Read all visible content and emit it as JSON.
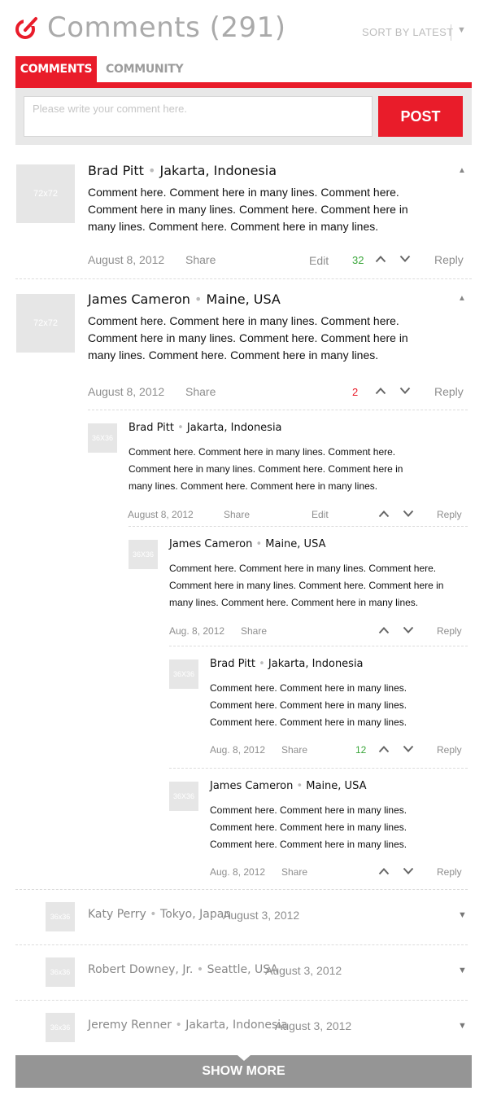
{
  "header": {
    "title": "Comments (291)",
    "sort_label": "SORT BY LATEST",
    "accent": "#e91c2a"
  },
  "tabs": [
    {
      "label": "COMMENTS",
      "active": true
    },
    {
      "label": "COMMUNITY",
      "active": false
    }
  ],
  "composer": {
    "placeholder": "Please write your comment here.",
    "post_label": "POST"
  },
  "placeholders": {
    "large": "72x72",
    "small": "36X36",
    "small_alt": "36x36"
  },
  "comments": [
    {
      "name": "Brad Pitt",
      "location": "Jakarta, Indonesia",
      "lines": [
        "Comment here. Comment here in many lines. Comment here.",
        "Comment here in many lines. Comment here. Comment here in",
        "many lines. Comment here. Comment here in many lines."
      ],
      "date": "August 8, 2012",
      "share": "Share",
      "edit": "Edit",
      "score": "32",
      "reply": "Reply"
    },
    {
      "name": "James Cameron",
      "location": "Maine, USA",
      "lines": [
        "Comment here. Comment here in many lines. Comment here.",
        "Comment here in many lines. Comment here. Comment here in",
        "many lines. Comment here. Comment here in many lines."
      ],
      "date": "August 8, 2012",
      "share": "Share",
      "score": "2",
      "reply": "Reply"
    },
    {
      "name": "Brad Pitt",
      "location": "Jakarta, Indonesia",
      "lines": [
        "Comment here. Comment here in many lines. Comment here.",
        "Comment here in many lines. Comment here. Comment here in",
        "many lines. Comment here. Comment here in many lines."
      ],
      "date": "August 8, 2012",
      "share": "Share",
      "edit": "Edit",
      "reply": "Reply"
    },
    {
      "name": "James Cameron",
      "location": "Maine, USA",
      "lines": [
        "Comment here. Comment here in many lines. Comment here.",
        "Comment here in many lines. Comment here. Comment here in",
        "many lines. Comment here. Comment here in many lines."
      ],
      "date": "Aug. 8, 2012",
      "share": "Share",
      "reply": "Reply"
    },
    {
      "name": "Brad Pitt",
      "location": "Jakarta, Indonesia",
      "lines": [
        "Comment here. Comment here in many lines.",
        "Comment here. Comment here in many lines.",
        "Comment here. Comment here in many lines."
      ],
      "date": "Aug. 8, 2012",
      "share": "Share",
      "score": "12",
      "reply": "Reply"
    },
    {
      "name": "James Cameron",
      "location": "Maine, USA",
      "lines": [
        "Comment here. Comment here in many lines.",
        "Comment here. Comment here in many lines.",
        "Comment here. Comment here in many lines."
      ],
      "date": "Aug. 8, 2012",
      "share": "Share",
      "reply": "Reply"
    }
  ],
  "collapsed": [
    {
      "name": "Katy Perry",
      "location": "Tokyo, Japan",
      "date": "August 3, 2012"
    },
    {
      "name": "Robert Downey, Jr.",
      "location": "Seattle, USA",
      "date": "August 3, 2012"
    },
    {
      "name": "Jeremy Renner",
      "location": "Jakarta, Indonesia",
      "date": "August 3, 2012"
    }
  ],
  "show_more_label": "SHOW MORE",
  "colors": {
    "score_positive": "#3aa63a",
    "score_negative": "#e91c2a"
  }
}
